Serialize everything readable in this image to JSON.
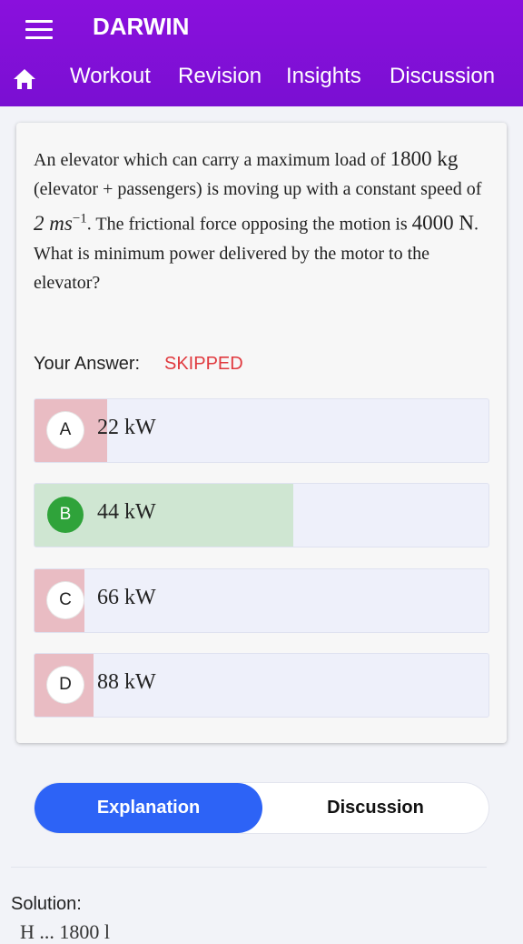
{
  "header": {
    "brand": "DARWIN",
    "menu_icon": "hamburger-menu-icon",
    "home_icon": "home-icon",
    "tabs": [
      {
        "label": "Workout"
      },
      {
        "label": "Revision"
      },
      {
        "label": "Insights"
      },
      {
        "label": "Discussion"
      }
    ],
    "color": "#7a0fd2"
  },
  "question": {
    "t1": "An elevator which can carry a maximum load of",
    "m1": "1800 kg",
    "t2": "(elevator + passengers) is moving up with a constant speed of",
    "m2": "2 ms",
    "m2_sup": "−1",
    "t3": ". The frictional force opposing the motion is",
    "m3": "4000 N",
    "t4": ". What is minimum power delivered by the motor to the elevator?"
  },
  "answer": {
    "label": "Your Answer:",
    "status": "SKIPPED",
    "status_color": "#e0393e"
  },
  "options": [
    {
      "letter": "A",
      "text": "22 kW",
      "correct": false,
      "response_fraction": 0.16
    },
    {
      "letter": "B",
      "text": "44 kW",
      "correct": true,
      "response_fraction": 0.57
    },
    {
      "letter": "C",
      "text": "66 kW",
      "correct": false,
      "response_fraction": 0.11
    },
    {
      "letter": "D",
      "text": "88 kW",
      "correct": false,
      "response_fraction": 0.13
    }
  ],
  "colors": {
    "wrong_fill": "#e9bcc3",
    "correct_fill": "#cfe6d2",
    "correct_badge": "#2fa33a",
    "accent": "#2d63f6"
  },
  "toggle": {
    "explanation": "Explanation",
    "discussion": "Discussion"
  },
  "solution": {
    "label": "Solution:",
    "partial": "H   ...   1800 l"
  }
}
